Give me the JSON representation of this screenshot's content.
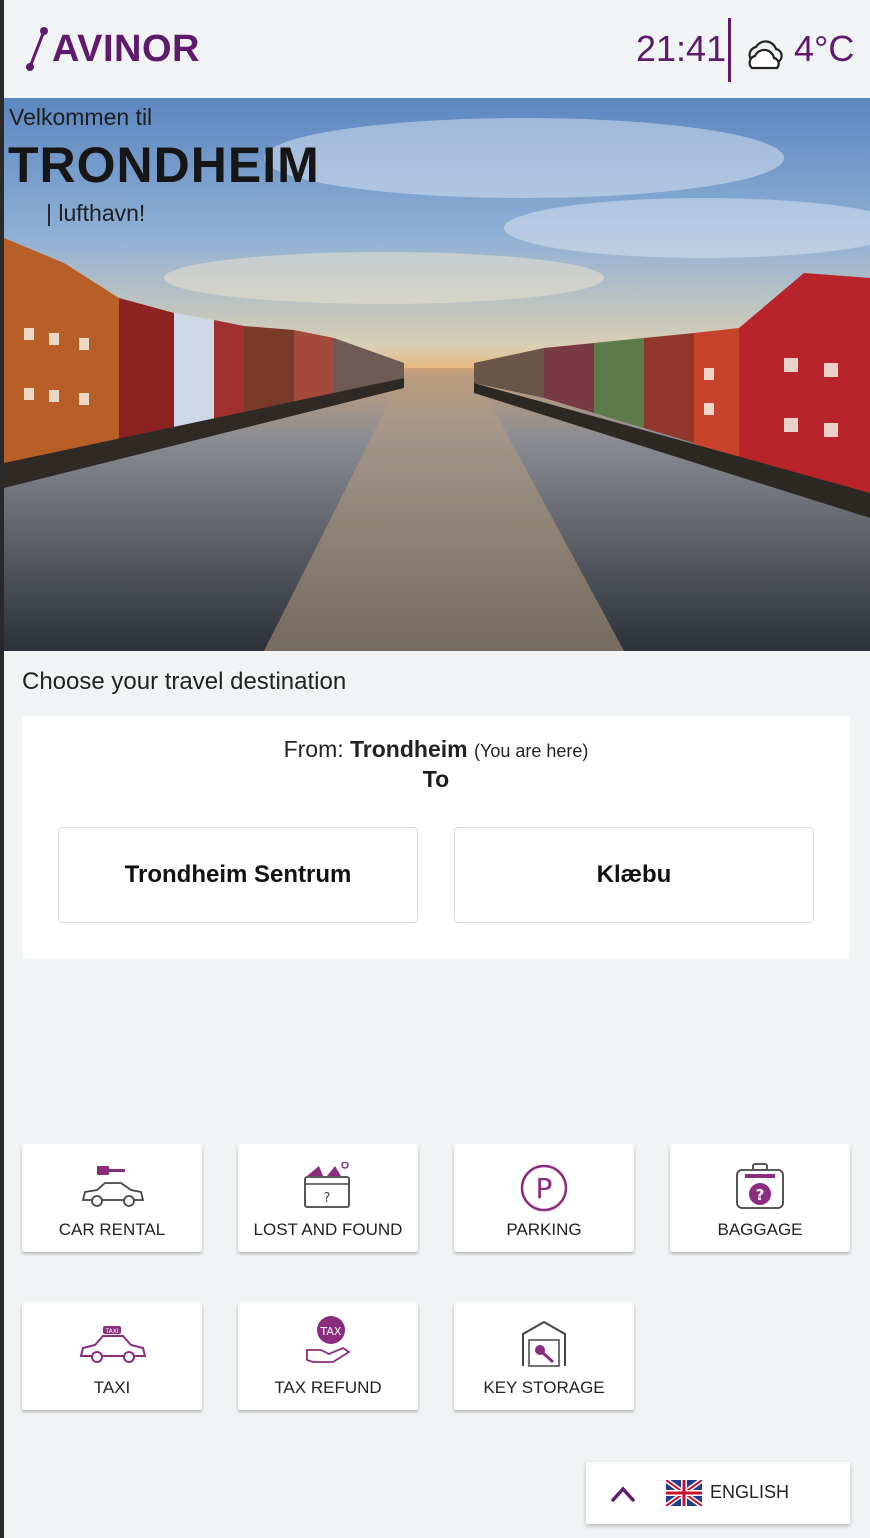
{
  "header": {
    "logo_text": "AVINOR",
    "time": "21:41",
    "temperature": "4°C",
    "weather_icon": "cloud-icon"
  },
  "hero": {
    "welcome": "Velkommen til",
    "city": "TRONDHEIM",
    "airport": "lufthavn!"
  },
  "destination": {
    "heading": "Choose your travel destination",
    "from_label": "From:",
    "from_city": "Trondheim",
    "from_note": "(You are here)",
    "to_label": "To",
    "options": [
      "Trondheim Sentrum",
      "Klæbu"
    ]
  },
  "services": [
    {
      "label": "CAR RENTAL",
      "icon": "car-key-icon"
    },
    {
      "label": "LOST AND FOUND",
      "icon": "lost-found-box-icon"
    },
    {
      "label": "PARKING",
      "icon": "parking-icon"
    },
    {
      "label": "BAGGAGE",
      "icon": "baggage-question-icon"
    },
    {
      "label": "TAXI",
      "icon": "taxi-icon"
    },
    {
      "label": "TAX REFUND",
      "icon": "tax-refund-icon"
    },
    {
      "label": "KEY STORAGE",
      "icon": "key-storage-icon"
    }
  ],
  "language": {
    "label": "ENGLISH",
    "flag_icon": "uk-flag-icon",
    "toggle_icon": "chevron-up-icon"
  },
  "colors": {
    "brand": "#5f1a6e",
    "background": "#f1f4f5",
    "icon_accent": "#8b2c7f"
  }
}
